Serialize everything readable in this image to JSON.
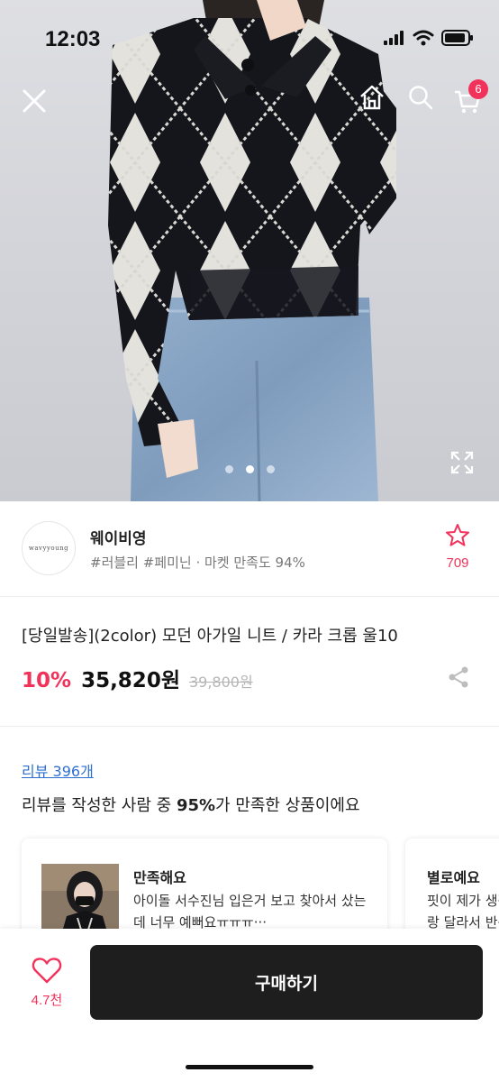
{
  "status_bar": {
    "time": "12:03"
  },
  "header": {
    "close_icon": "close-icon",
    "home_icon": "home-icon",
    "search_icon": "search-icon",
    "cart_icon": "cart-icon",
    "cart_count": "6"
  },
  "gallery": {
    "page_count": 3,
    "active_index": 1,
    "expand_icon": "expand-icon"
  },
  "shop": {
    "logo_text": "wavyyoung",
    "name": "웨이비영",
    "tags": "#러블리 #페미닌 · 마켓 만족도 94%",
    "favorite_count": "709"
  },
  "product": {
    "title": "[당일발송](2color) 모던 아가일 니트 / 카라 크롭 울10",
    "discount": "10%",
    "price": "35,820원",
    "original_price": "39,800원"
  },
  "reviews": {
    "link_label": "리뷰 396개",
    "summary_prefix": "리뷰를 작성한 사람 중 ",
    "summary_highlight": "95%",
    "summary_suffix": "가 만족한 상품이에요",
    "cards": [
      {
        "rating": "만족해요",
        "text": "아이돌 서수진님 입은거 보고 찾아서 샀는데 너무 예뻐요ㅠㅠㅠ···"
      },
      {
        "rating": "별로예요",
        "text": "핏이 제가 생각한거랑 달라서 반품 했어요"
      }
    ]
  },
  "bottom_bar": {
    "like_count": "4.7천",
    "buy_label": "구매하기"
  },
  "colors": {
    "accent": "#f1325a",
    "link": "#2f6fd0",
    "buy_button": "#1e1e1e"
  }
}
